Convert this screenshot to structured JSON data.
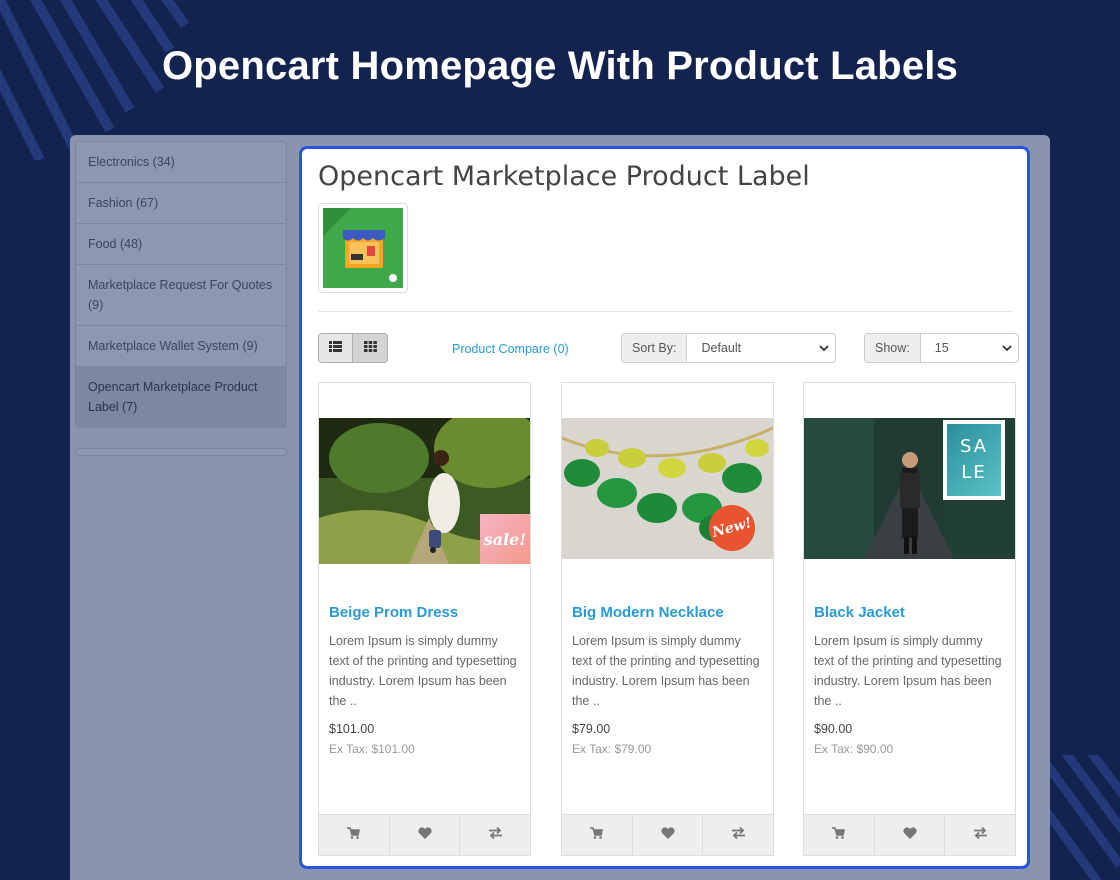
{
  "hero": {
    "title": "Opencart Homepage With Product Labels"
  },
  "sidebar": {
    "items": [
      {
        "label": "Electronics (34)"
      },
      {
        "label": "Fashion (67)"
      },
      {
        "label": "Food (48)"
      },
      {
        "label": "Marketplace Request For Quotes (9)"
      },
      {
        "label": "Marketplace Wallet System (9)"
      },
      {
        "label": "Opencart Marketplace Product Label (7)"
      }
    ]
  },
  "page": {
    "title": "Opencart Marketplace Product Label",
    "product_compare": "Product Compare (0)",
    "sort_label": "Sort By:",
    "sort_value": "Default",
    "show_label": "Show:",
    "show_value": "15"
  },
  "products": [
    {
      "name": "Beige Prom Dress",
      "desc": "Lorem Ipsum is simply dummy text of the printing and typesetting industry. Lorem Ipsum has been the ..",
      "price": "$101.00",
      "tax": "Ex Tax: $101.00",
      "badge": "sale!"
    },
    {
      "name": "Big Modern Necklace",
      "desc": "Lorem Ipsum is simply dummy text of the printing and typesetting industry. Lorem Ipsum has been the ..",
      "price": "$79.00",
      "tax": "Ex Tax: $79.00",
      "badge": "New!"
    },
    {
      "name": "Black Jacket",
      "desc": "Lorem Ipsum is simply dummy text of the printing and typesetting industry. Lorem Ipsum has been the ..",
      "price": "$90.00",
      "tax": "Ex Tax: $90.00",
      "badge": "SALE"
    }
  ],
  "colors": {
    "background": "#132350",
    "accent_border": "#2a53e0",
    "link": "#2a9ad5"
  },
  "icons": {
    "view_list": "list-view-icon",
    "view_grid": "grid-view-icon",
    "cart": "cart-icon",
    "wishlist": "heart-icon",
    "compare": "compare-icon"
  }
}
